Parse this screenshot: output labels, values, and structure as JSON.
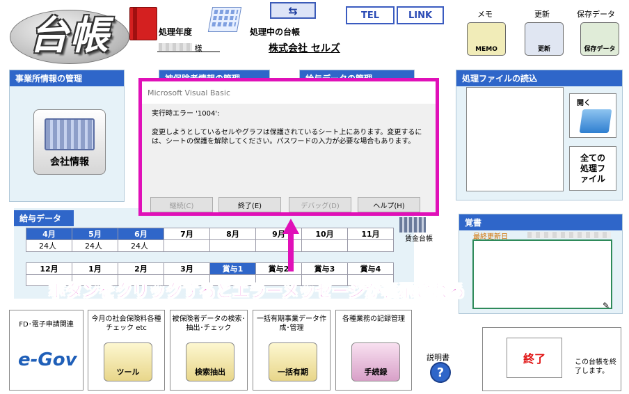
{
  "header": {
    "logo": "台帳",
    "year_label": "処理年度",
    "current_label": "処理中の台帳",
    "tel_label": "TEL",
    "link_label": "LINK",
    "company_name": "株式会社 セルズ",
    "user_suffix": "様",
    "icons": [
      {
        "label": "メモ",
        "caption": "MEMO",
        "icon": "memo-icon"
      },
      {
        "label": "更新",
        "caption": "更新",
        "icon": "new-icon"
      },
      {
        "label": "保存データ",
        "caption": "保存データ",
        "icon": "toolbox-icon"
      }
    ]
  },
  "office_panel": {
    "title": "事業所情報の管理",
    "button_label": "会社情報"
  },
  "hidden_panels": {
    "insured_title": "被保険者情報の管理",
    "salary_title": "給与データの管理"
  },
  "dialog": {
    "title": "Microsoft Visual Basic",
    "error_line": "実行時エラー '1004':",
    "message": "変更しようとしているセルやグラフは保護されているシート上にあります。変更するには、シートの保護を解除してください。パスワードの入力が必要な場合もあります。",
    "buttons": {
      "continue": "継続(C)",
      "end": "終了(E)",
      "debug": "デバッグ(D)",
      "help": "ヘルプ(H)"
    }
  },
  "salary": {
    "title": "給与データ",
    "months_row1": [
      "4月",
      "5月",
      "6月",
      "7月",
      "8月",
      "9月",
      "10月",
      "11月"
    ],
    "values_row1": [
      "24人",
      "24人",
      "24人",
      "",
      "",
      "",
      "",
      ""
    ],
    "months_row2": [
      "12月",
      "1月",
      "2月",
      "3月",
      "賞与1",
      "賞与2",
      "賞与3",
      "賞与4"
    ],
    "values_row2": [
      "",
      "",
      "",
      "",
      "",
      "",
      "",
      ""
    ],
    "active_row1": [
      0,
      1,
      2
    ],
    "active_row2": [
      4
    ],
    "wage_ledger_label": "賃金台帳"
  },
  "file_panel": {
    "title": "処理ファイルの読込",
    "open_label": "開く",
    "all_files_label": "全ての処理ファイル"
  },
  "memo_panel": {
    "title": "覚書",
    "last_updated_label": "最終更新日"
  },
  "overlay": {
    "caption": "ボタンをクリックするとエラーメッセージが表示される",
    "color": "#e010b8"
  },
  "bottom_cards": [
    {
      "text": "FD･電子申請関連",
      "icon_label": "e-Gov",
      "icon": "egov-icon"
    },
    {
      "text": "今月の社会保険料各種チェック etc",
      "icon_label": "ツール",
      "icon": "tool-icon"
    },
    {
      "text": "被保険者データの検索･抽出･チェック",
      "icon_label": "検索抽出",
      "icon": "search-icon"
    },
    {
      "text": "一括有期事業データ作成･管理",
      "icon_label": "一括有期",
      "icon": "shovel-icon"
    },
    {
      "text": "各種業務の記録管理",
      "icon_label": "手続録",
      "icon": "stamp-icon"
    }
  ],
  "manual": {
    "label": "説明書",
    "icon": "question-icon"
  },
  "exit": {
    "label": "終了",
    "description": "この台帳を終了します。"
  },
  "colors": {
    "accent": "#2f66c9",
    "highlight": "#e010b8",
    "panel_bg": "#e6f2f8"
  }
}
